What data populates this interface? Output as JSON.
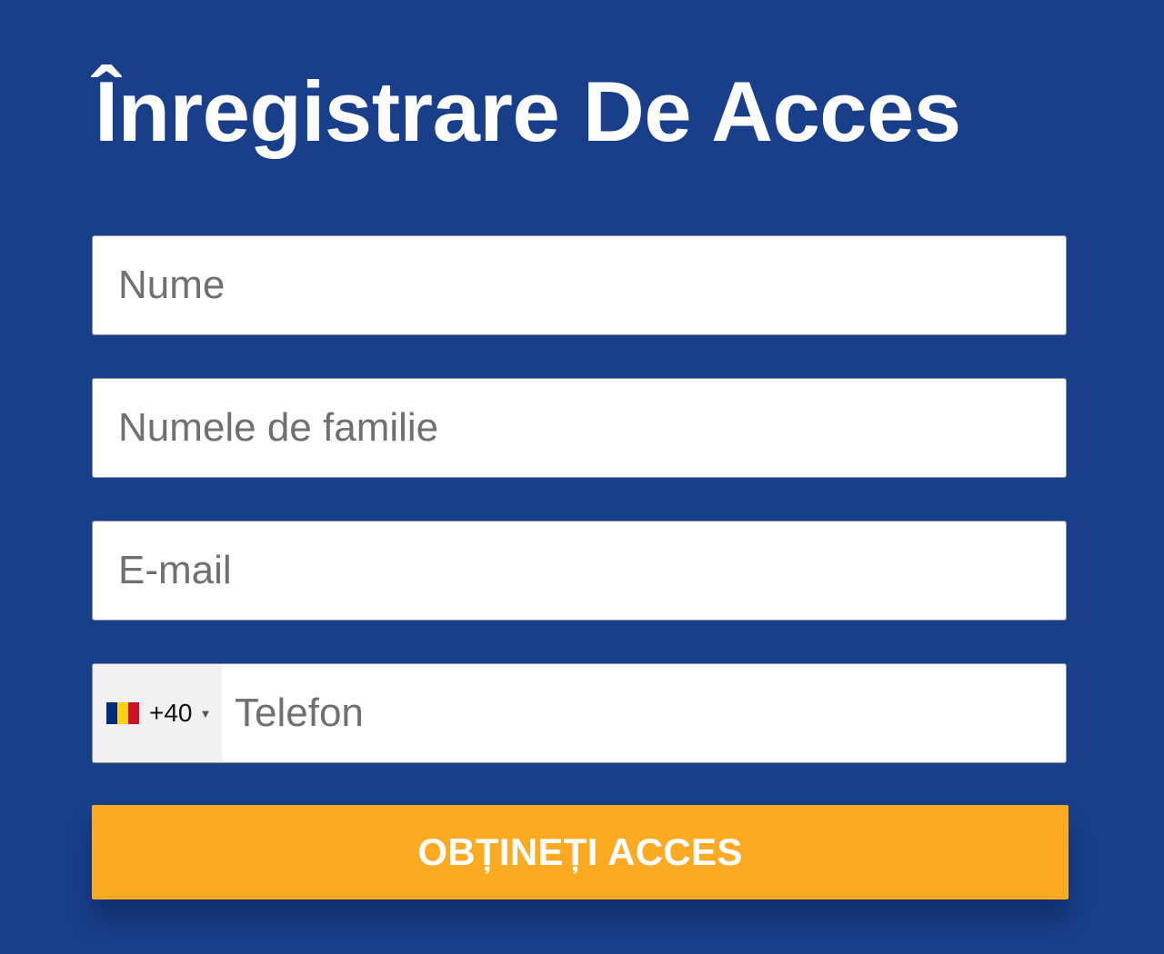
{
  "form": {
    "title": "Înregistrare De Acces",
    "first_name": {
      "placeholder": "Nume",
      "value": ""
    },
    "last_name": {
      "placeholder": "Numele de familie",
      "value": ""
    },
    "email": {
      "placeholder": "E-mail",
      "value": ""
    },
    "phone": {
      "country_code": "+40",
      "flag_icon": "romania-flag-icon",
      "flag_colors": [
        "#002b7f",
        "#fcd116",
        "#ce1126"
      ],
      "placeholder": "Telefon",
      "value": ""
    },
    "submit_label": "OBȚINEȚI ACCES"
  },
  "colors": {
    "background": "#193f8b",
    "button": "#fbaa22",
    "title_text": "#ffffff"
  }
}
